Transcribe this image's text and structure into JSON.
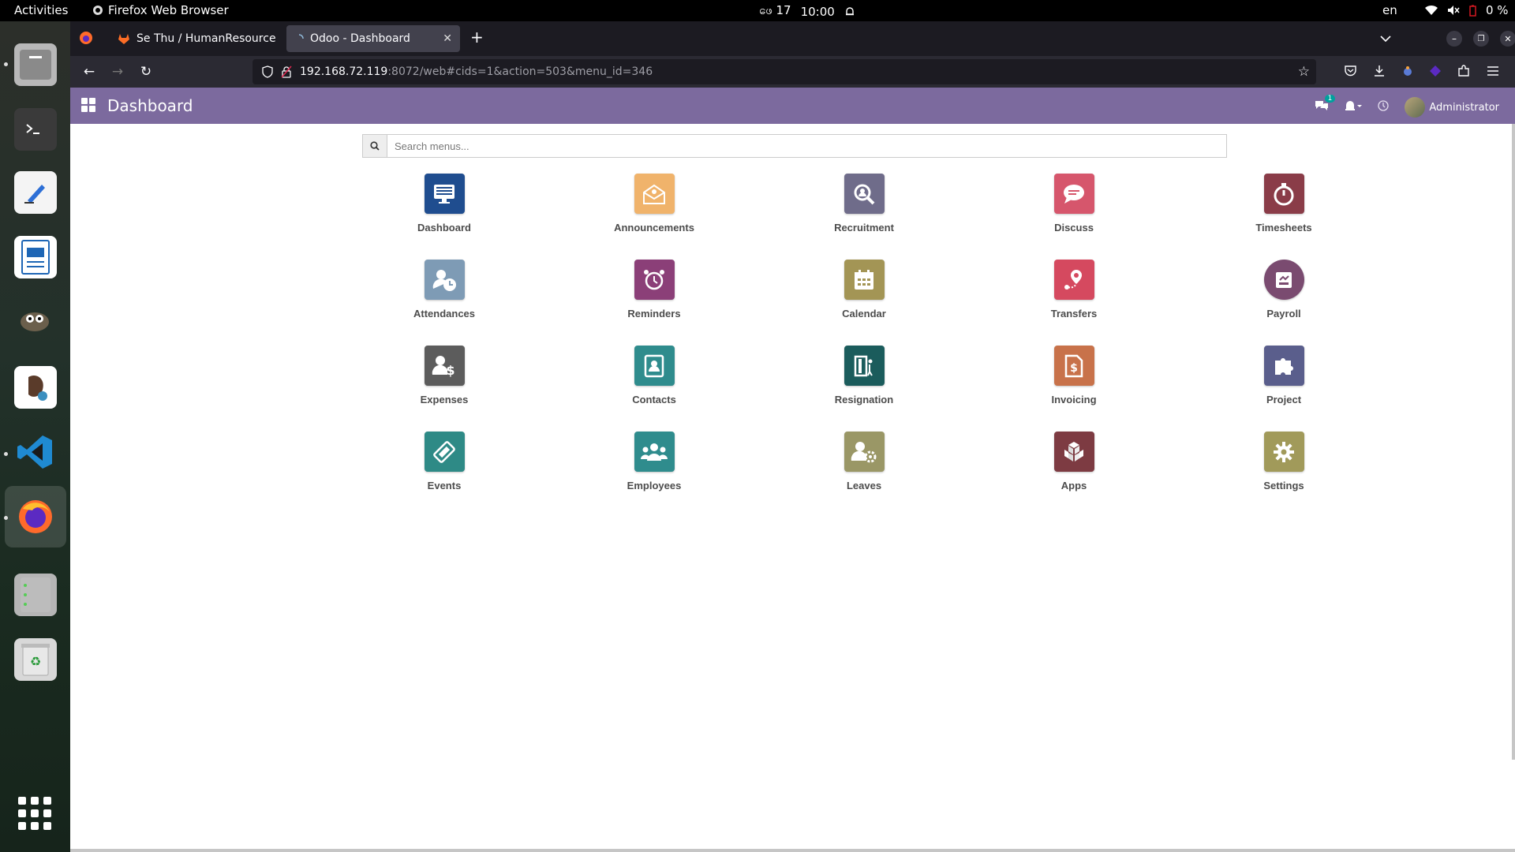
{
  "system_bar": {
    "activities": "Activities",
    "app_name": "Firefox Web Browser",
    "date": "ဖေ 17",
    "time": "10:00",
    "language": "en",
    "battery": "0 %"
  },
  "browser": {
    "tabs": [
      {
        "title": "Se Thu / HumanResource"
      },
      {
        "title": "Odoo - Dashboard"
      }
    ],
    "url_host": "192.168.72.119",
    "url_rest": ":8072/web#cids=1&action=503&menu_id=346"
  },
  "odoo": {
    "title": "Dashboard",
    "messages_count": "1",
    "user": "Administrator",
    "search_placeholder": "Search menus..."
  },
  "apps": [
    {
      "label": "Dashboard",
      "color": "#1f4d8f",
      "icon": "monitor-icon"
    },
    {
      "label": "Announcements",
      "color": "#f0b36b",
      "icon": "envelope-icon"
    },
    {
      "label": "Recruitment",
      "color": "#6f6c8a",
      "icon": "magnifier-icon"
    },
    {
      "label": "Discuss",
      "color": "#d6566c",
      "icon": "chat-icon"
    },
    {
      "label": "Timesheets",
      "color": "#8a3c48",
      "icon": "stopwatch-icon"
    },
    {
      "label": "Attendances",
      "color": "#7e9bb5",
      "icon": "user-clock-icon"
    },
    {
      "label": "Reminders",
      "color": "#8b3f78",
      "icon": "alarm-icon"
    },
    {
      "label": "Calendar",
      "color": "#a39555",
      "icon": "calendar-icon"
    },
    {
      "label": "Transfers",
      "color": "#d5495f",
      "icon": "map-pin-icon"
    },
    {
      "label": "Payroll",
      "color": "#7a4b70",
      "icon": "payroll-icon"
    },
    {
      "label": "Expenses",
      "color": "#5c5c5c",
      "icon": "user-dollar-icon"
    },
    {
      "label": "Contacts",
      "color": "#2f8c8d",
      "icon": "address-book-icon"
    },
    {
      "label": "Resignation",
      "color": "#1b5c5c",
      "icon": "door-exit-icon"
    },
    {
      "label": "Invoicing",
      "color": "#c8724a",
      "icon": "invoice-icon"
    },
    {
      "label": "Project",
      "color": "#5a5e8c",
      "icon": "puzzle-icon"
    },
    {
      "label": "Events",
      "color": "#2e8a86",
      "icon": "ticket-icon"
    },
    {
      "label": "Employees",
      "color": "#2f8c8d",
      "icon": "users-icon"
    },
    {
      "label": "Leaves",
      "color": "#9a9766",
      "icon": "user-gear-icon"
    },
    {
      "label": "Apps",
      "color": "#7d3b42",
      "icon": "cubes-icon"
    },
    {
      "label": "Settings",
      "color": "#a19a5a",
      "icon": "gear-icon"
    }
  ]
}
